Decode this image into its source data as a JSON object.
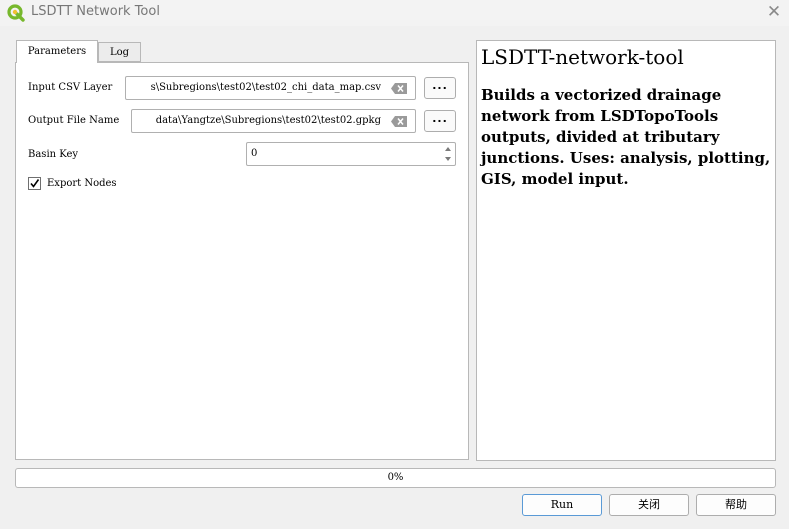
{
  "window": {
    "title": "LSDTT Network Tool",
    "close_glyph": "✕"
  },
  "tabs": [
    {
      "label": "Parameters",
      "active": true
    },
    {
      "label": "Log",
      "active": false
    }
  ],
  "params": {
    "input_label": "Input CSV Layer",
    "input_value": "s\\Subregions\\test02\\test02_chi_data_map.csv",
    "output_label": "Output File Name",
    "output_value": "data\\Yangtze\\Subregions\\test02\\test02.gpkg",
    "browse_label": "...",
    "basin_key_label": "Basin Key",
    "basin_key_value": "0",
    "export_nodes_label": "Export Nodes",
    "export_nodes_checked": true
  },
  "help": {
    "title": "LSDTT-network-tool",
    "description": "Builds a vectorized drainage network from LSDTopoTools outputs, divided at tributary junctions. Uses: analysis, plotting, GIS, model input."
  },
  "progress": {
    "value": 0,
    "text": "0%"
  },
  "buttons": {
    "run": "Run",
    "close": "关闭",
    "help": "帮助"
  },
  "icons": {
    "app": "qgis-logo-icon",
    "clear": "clear-text-icon",
    "check": "checkmark-icon",
    "spin": "spin-arrows-icon"
  },
  "colors": {
    "qgis_green": "#77b82c",
    "qgis_yellow": "#f1c232",
    "default_button_border": "#5a9ad6"
  }
}
